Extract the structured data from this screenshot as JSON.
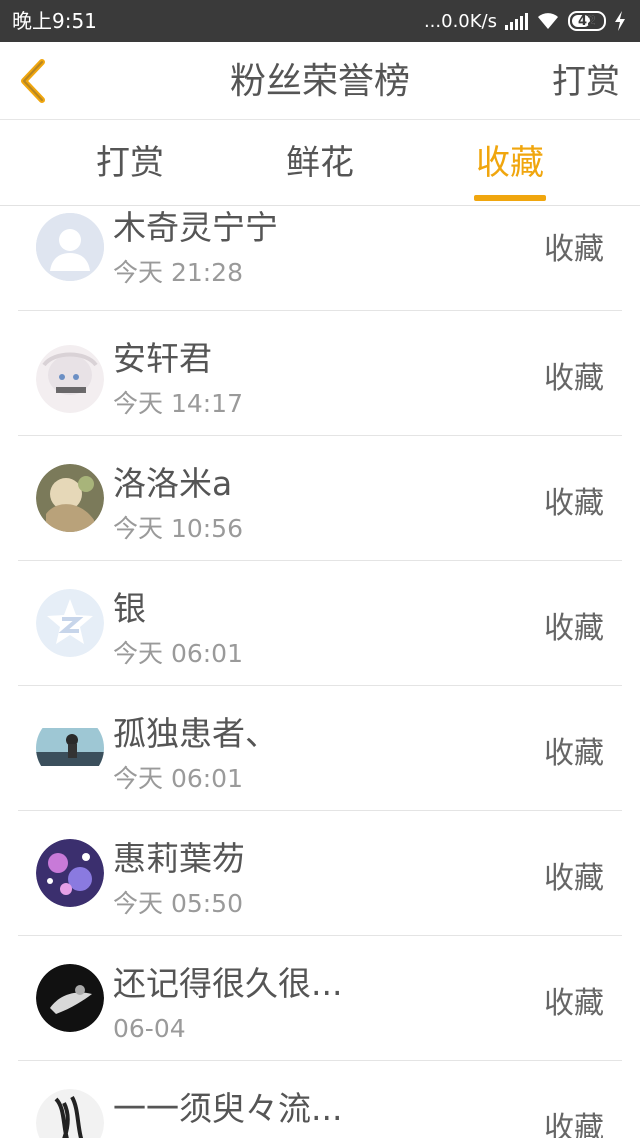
{
  "status_bar": {
    "time": "晚上9:51",
    "network_speed": "...0.0K/s",
    "battery": "42"
  },
  "header": {
    "title": "粉丝荣誉榜",
    "action": "打赏"
  },
  "tabs": [
    {
      "label": "打赏",
      "active": false
    },
    {
      "label": "鲜花",
      "active": false
    },
    {
      "label": "收藏",
      "active": true
    }
  ],
  "accent_color": "#f0a60e",
  "fans": [
    {
      "name": "木奇灵宁宁",
      "time": "今天 21:28",
      "action": "收藏",
      "avatar": "default-avatar"
    },
    {
      "name": "安轩君",
      "time": "今天 14:17",
      "action": "收藏",
      "avatar": "anime-girl-avatar"
    },
    {
      "name": "洛洛米a",
      "time": "今天 10:56",
      "action": "收藏",
      "avatar": "illustration-avatar"
    },
    {
      "name": "银",
      "time": "今天 06:01",
      "action": "收藏",
      "avatar": "qq-star-avatar"
    },
    {
      "name": "孤独患者、",
      "time": "今天 06:01",
      "action": "收藏",
      "avatar": "photo-avatar"
    },
    {
      "name": "惠莉葉芴",
      "time": "今天 05:50",
      "action": "收藏",
      "avatar": "galaxy-avatar"
    },
    {
      "name": "还记得很久很...",
      "time": "06-04",
      "action": "收藏",
      "avatar": "dark-avatar"
    },
    {
      "name": "一一须臾々流...",
      "time": "",
      "action": "收藏",
      "avatar": "sketch-avatar"
    }
  ]
}
